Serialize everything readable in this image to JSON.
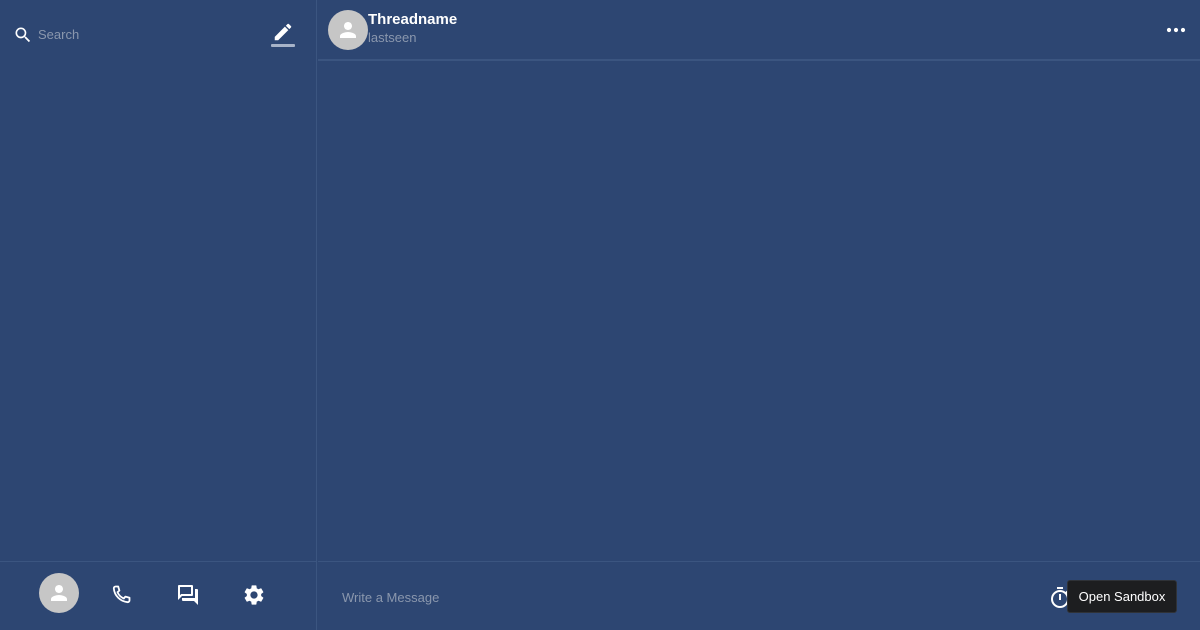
{
  "sidebar": {
    "search": {
      "placeholder": "Search",
      "value": "",
      "icon": "search-icon"
    },
    "compose": {
      "icon": "pencil-icon"
    },
    "footer": {
      "items": [
        {
          "name": "profile",
          "icon": "person-icon"
        },
        {
          "name": "calls",
          "icon": "phone-icon"
        },
        {
          "name": "chats",
          "icon": "chat-bubbles-icon"
        },
        {
          "name": "settings",
          "icon": "gear-icon"
        }
      ]
    }
  },
  "thread": {
    "name": "Threadname",
    "status": "lastseen",
    "menu_icon": "more-horizontal-icon"
  },
  "composer": {
    "placeholder": "Write a Message",
    "value": "",
    "timer_icon": "stopwatch-icon",
    "sandbox_label": "Open Sandbox"
  },
  "colors": {
    "background": "#2d4672",
    "divider": "#3b5580",
    "avatar": "#c6c6c6",
    "muted_text": "#8a97ad",
    "sandbox_button": "#1d1e20"
  }
}
